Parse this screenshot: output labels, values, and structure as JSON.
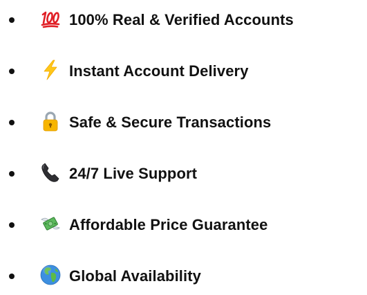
{
  "features": {
    "items": [
      {
        "icon": "hundred-points-emoji",
        "label": "100% Real & Verified Accounts"
      },
      {
        "icon": "high-voltage-emoji",
        "label": "Instant Account Delivery"
      },
      {
        "icon": "locked-padlock-emoji",
        "label": "Safe & Secure Transactions"
      },
      {
        "icon": "telephone-receiver-emoji",
        "label": "24/7 Live Support"
      },
      {
        "icon": "money-with-wings-emoji",
        "label": "Affordable Price Guarantee"
      },
      {
        "icon": "globe-europe-africa-emoji",
        "label": "Global Availability"
      }
    ]
  }
}
